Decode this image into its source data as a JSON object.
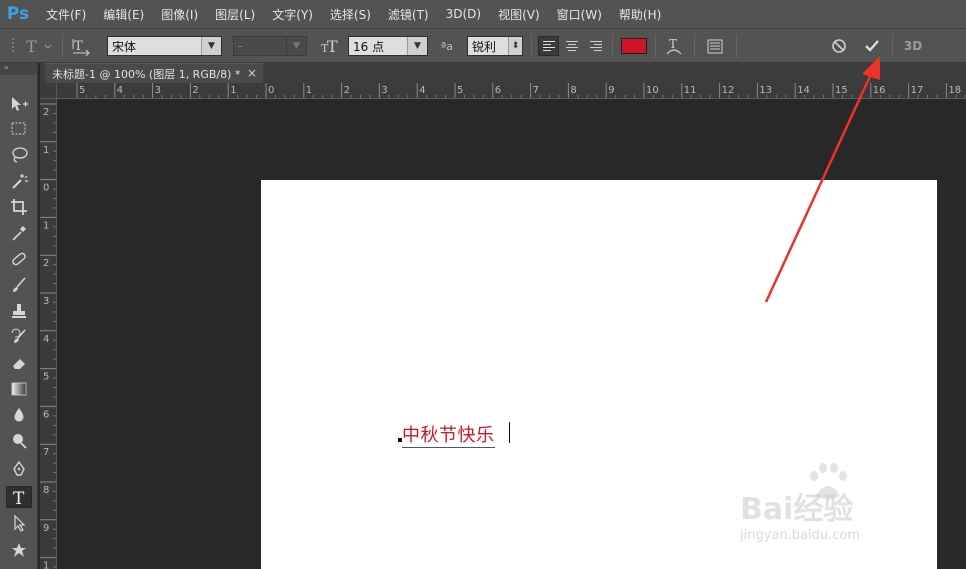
{
  "app": {
    "logo": "Ps",
    "menu": [
      "文件(F)",
      "编辑(E)",
      "图像(I)",
      "图层(L)",
      "文字(Y)",
      "选择(S)",
      "滤镜(T)",
      "3D(D)",
      "视图(V)",
      "窗口(W)",
      "帮助(H)"
    ]
  },
  "options": {
    "font_family": "宋体",
    "font_style": "-",
    "font_size": "16 点",
    "anti_alias": "锐利",
    "text_color": "#d2142b",
    "threed_label": "3D",
    "aa_glyph": "ªa"
  },
  "document": {
    "tab_title": "未标题-1 @ 100% (图层 1, RGB/8) *",
    "close_glyph": "×",
    "text": "中秋节快乐"
  },
  "rulers": {
    "horizontal": [
      "5",
      "4",
      "3",
      "2",
      "1",
      "0",
      "1",
      "2",
      "3",
      "4",
      "5",
      "6",
      "7",
      "8",
      "9",
      "10",
      "11",
      "12",
      "13",
      "14",
      "15",
      "16",
      "17",
      "18"
    ],
    "vertical": [
      "2",
      "1",
      "0",
      "1",
      "2",
      "3",
      "4",
      "5",
      "6",
      "7",
      "8",
      "9",
      "1"
    ]
  },
  "watermark": {
    "brand": "Bai经验",
    "url": "jingyan.baidu.com"
  },
  "annotation": {
    "arrow_color": "#f0302a"
  }
}
